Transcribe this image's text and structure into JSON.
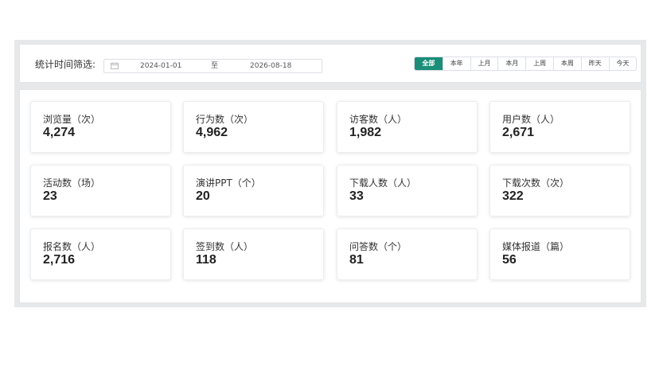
{
  "filter": {
    "label": "统计时间筛选:",
    "start_date": "2024-01-01",
    "separator": "至",
    "end_date": "2026-08-18",
    "ranges": [
      "全部",
      "本年",
      "上月",
      "本月",
      "上周",
      "本周",
      "昨天",
      "今天"
    ],
    "active_range": "全部",
    "accent_color": "#1a8e78"
  },
  "stats": [
    {
      "label": "浏览量（次）",
      "value": "4,274"
    },
    {
      "label": "行为数（次）",
      "value": "4,962"
    },
    {
      "label": "访客数（人）",
      "value": "1,982"
    },
    {
      "label": "用户数（人）",
      "value": "2,671"
    },
    {
      "label": "活动数（场）",
      "value": "23"
    },
    {
      "label": "演讲PPT（个）",
      "value": "20"
    },
    {
      "label": "下载人数（人）",
      "value": "33"
    },
    {
      "label": "下载次数（次）",
      "value": "322"
    },
    {
      "label": "报名数（人）",
      "value": "2,716"
    },
    {
      "label": "签到数（人）",
      "value": "118"
    },
    {
      "label": "问答数（个）",
      "value": "81"
    },
    {
      "label": "媒体报道（篇）",
      "value": "56"
    }
  ]
}
